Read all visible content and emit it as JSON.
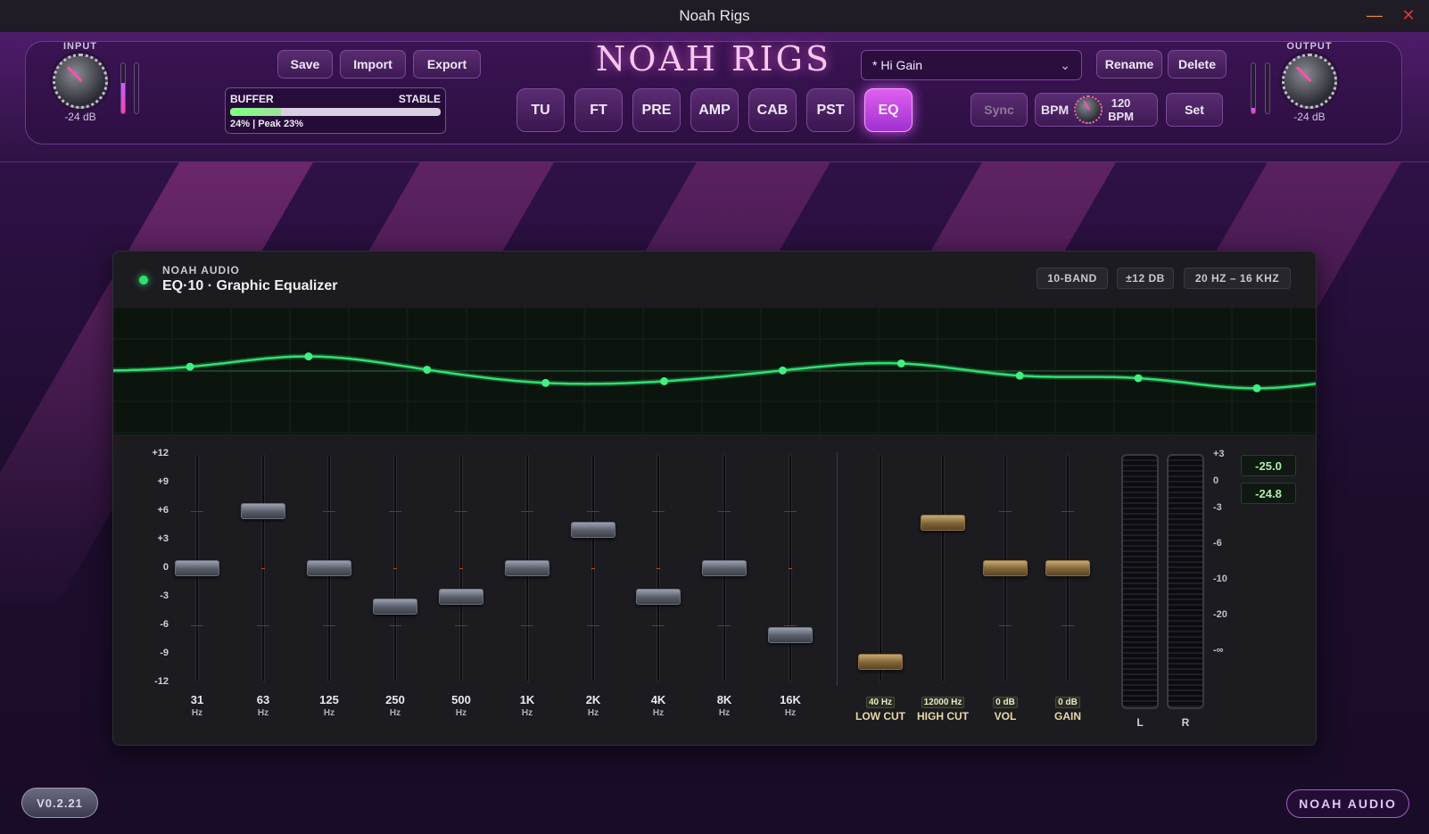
{
  "window": {
    "title": "Noah Rigs"
  },
  "header": {
    "brand": "NOAH RIGS",
    "input": {
      "label": "INPUT",
      "value": "-24 dB",
      "meter_level": 0.6
    },
    "output": {
      "label": "OUTPUT",
      "value": "-24 dB",
      "meter_level": 0.1
    },
    "buttons": {
      "save": "Save",
      "import": "Import",
      "export": "Export",
      "rename": "Rename",
      "delete": "Delete",
      "sync": "Sync",
      "set": "Set"
    },
    "buffer": {
      "label": "BUFFER",
      "status": "STABLE",
      "info": "24% | Peak 23%",
      "level": 0.24
    },
    "tabs": [
      {
        "label": "TU",
        "active": false
      },
      {
        "label": "FT",
        "active": false
      },
      {
        "label": "PRE",
        "active": false
      },
      {
        "label": "AMP",
        "active": false
      },
      {
        "label": "CAB",
        "active": false
      },
      {
        "label": "PST",
        "active": false
      },
      {
        "label": "EQ",
        "active": true
      }
    ],
    "preset": {
      "name": "* Hi Gain"
    },
    "bpm": {
      "label": "BPM",
      "value": "120",
      "unit": "BPM"
    }
  },
  "eq": {
    "maker": "NOAH AUDIO",
    "name": "EQ·10 · Graphic Equalizer",
    "badges": [
      "10-BAND",
      "±12 DB",
      "20 HZ – 16 KHZ"
    ],
    "db_scale": [
      "+12",
      "+9",
      "+6",
      "+3",
      "0",
      "-3",
      "-6",
      "-9",
      "-12"
    ],
    "bands": [
      {
        "freq": "31",
        "unit": "Hz",
        "gain": 0
      },
      {
        "freq": "63",
        "unit": "Hz",
        "gain": 6
      },
      {
        "freq": "125",
        "unit": "Hz",
        "gain": 0
      },
      {
        "freq": "250",
        "unit": "Hz",
        "gain": -4
      },
      {
        "freq": "500",
        "unit": "Hz",
        "gain": -3
      },
      {
        "freq": "1K",
        "unit": "Hz",
        "gain": 0
      },
      {
        "freq": "2K",
        "unit": "Hz",
        "gain": 4
      },
      {
        "freq": "4K",
        "unit": "Hz",
        "gain": -3
      },
      {
        "freq": "8K",
        "unit": "Hz",
        "gain": 0
      },
      {
        "freq": "16K",
        "unit": "Hz",
        "gain": -7
      }
    ],
    "aux": [
      {
        "value": "40 Hz",
        "name": "LOW CUT",
        "level": 0.09
      },
      {
        "value": "12000 Hz",
        "name": "HIGH CUT",
        "level": 0.7
      },
      {
        "value": "0 dB",
        "name": "VOL",
        "level": 0.5
      },
      {
        "value": "0 dB",
        "name": "GAIN",
        "level": 0.5
      }
    ],
    "meter": {
      "left_label": "L",
      "right_label": "R",
      "scale": [
        "+3",
        "0",
        "-3",
        "-6",
        "-10",
        "-20",
        "-∞"
      ],
      "readouts": [
        "-25.0",
        "-24.8"
      ]
    }
  },
  "footer": {
    "version": "V0.2.21",
    "logo": "NOAH AUDIO"
  },
  "colors": {
    "accent": "#e060f0",
    "eq_curve": "#30e070",
    "led": "#30e070"
  }
}
